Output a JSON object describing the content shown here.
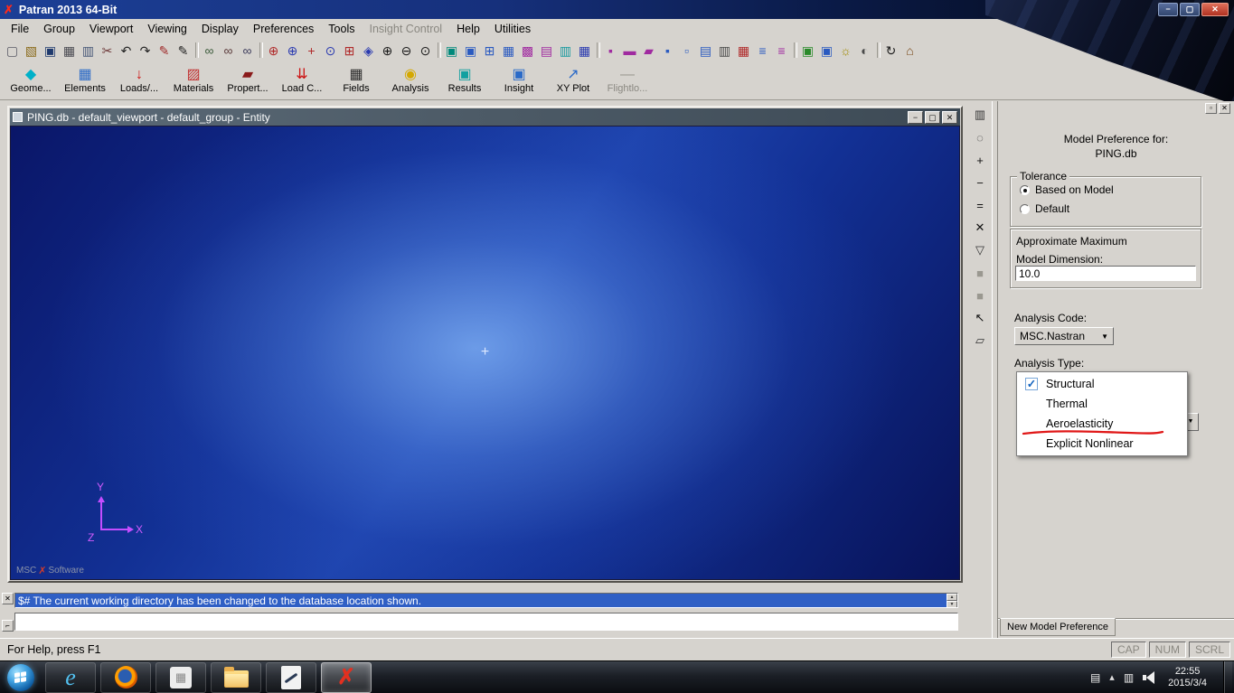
{
  "titlebar": {
    "title": "Patran 2013 64-Bit",
    "logo_glyph": "✗"
  },
  "icons": {
    "minimize": "−",
    "restore": "▢",
    "close": "✕",
    "float": "▫",
    "dock": "⌐",
    "check": "✓",
    "arrow_down": "▼",
    "arrow_up": "▲"
  },
  "menubar": {
    "items": [
      {
        "name": "menu-file",
        "label": "File"
      },
      {
        "name": "menu-group",
        "label": "Group"
      },
      {
        "name": "menu-viewport",
        "label": "Viewport"
      },
      {
        "name": "menu-viewing",
        "label": "Viewing"
      },
      {
        "name": "menu-display",
        "label": "Display"
      },
      {
        "name": "menu-preferences",
        "label": "Preferences"
      },
      {
        "name": "menu-tools",
        "label": "Tools"
      },
      {
        "name": "menu-insight-control",
        "label": "Insight Control",
        "disabled": true
      },
      {
        "name": "menu-help",
        "label": "Help"
      },
      {
        "name": "menu-utilities",
        "label": "Utilities"
      }
    ]
  },
  "toolbar_icons": [
    {
      "n": "new-file-icon",
      "g": "▢",
      "c": "#5a5a66"
    },
    {
      "n": "open-file-icon",
      "g": "▧",
      "c": "#8a6a1a"
    },
    {
      "n": "save-file-icon",
      "g": "▣",
      "c": "#1f3a6e"
    },
    {
      "n": "print-icon",
      "g": "▦",
      "c": "#4a4a52"
    },
    {
      "n": "copy-icon",
      "g": "▥",
      "c": "#4a5a7a"
    },
    {
      "n": "cut-icon",
      "g": "✂",
      "c": "#6e3a3a"
    },
    {
      "n": "undo-icon",
      "g": "↶",
      "c": "#222222"
    },
    {
      "n": "redo-icon",
      "g": "↷",
      "c": "#222222"
    },
    {
      "n": "brush-icon",
      "g": "✎",
      "c": "#a02a2a"
    },
    {
      "n": "pencil-icon",
      "g": "✎",
      "c": "#222222"
    },
    {
      "n": "toolbar-separator",
      "sep": true
    },
    {
      "n": "smooth-shaded-icon",
      "g": "∞",
      "c": "#3a5a3a"
    },
    {
      "n": "wireframe-icon",
      "g": "∞",
      "c": "#5a3a3a"
    },
    {
      "n": "hidden-line-icon",
      "g": "∞",
      "c": "#3a3a5a"
    },
    {
      "n": "toolbar-separator",
      "sep": true
    },
    {
      "n": "rotate-xy-icon",
      "g": "⊕",
      "c": "#b02a2a"
    },
    {
      "n": "rotate-z-icon",
      "g": "⊕",
      "c": "#2a3ab0"
    },
    {
      "n": "pan-icon",
      "g": "+",
      "c": "#b02a2a"
    },
    {
      "n": "center-view-icon",
      "g": "⊙",
      "c": "#2a3ab0"
    },
    {
      "n": "front-view-icon",
      "g": "⊞",
      "c": "#b02a2a"
    },
    {
      "n": "iso-view-icon",
      "g": "◈",
      "c": "#2a3ab0"
    },
    {
      "n": "zoom-in-icon",
      "g": "⊕",
      "c": "#1a1a1a"
    },
    {
      "n": "zoom-out-icon",
      "g": "⊖",
      "c": "#1a1a1a"
    },
    {
      "n": "zoom-box-icon",
      "g": "⊙",
      "c": "#1a1a1a"
    },
    {
      "n": "toolbar-separator",
      "sep": true
    },
    {
      "n": "view-cube-teal-icon",
      "g": "▣",
      "c": "#00897b"
    },
    {
      "n": "view-cube-blue-icon",
      "g": "▣",
      "c": "#2a5ac0"
    },
    {
      "n": "view-corner-icon",
      "g": "⊞",
      "c": "#2a5ac0"
    },
    {
      "n": "view-grid-icon",
      "g": "▦",
      "c": "#2a5ac0"
    },
    {
      "n": "label-grid-icon",
      "g": "▩",
      "c": "#a02aa0"
    },
    {
      "n": "show-labels-icon",
      "g": "▤",
      "c": "#a02aa0"
    },
    {
      "n": "hide-labels-icon",
      "g": "▥",
      "c": "#1a9aa0"
    },
    {
      "n": "plot-markers-icon",
      "g": "▦",
      "c": "#2a3ab0"
    },
    {
      "n": "toolbar-separator",
      "sep": true
    },
    {
      "n": "point-label-icon",
      "g": "▪",
      "c": "#a02aa0"
    },
    {
      "n": "curve-label-icon",
      "g": "▬",
      "c": "#a02aa0"
    },
    {
      "n": "surface-label-icon",
      "g": "▰",
      "c": "#a02aa0"
    },
    {
      "n": "node-label-icon",
      "g": "▪",
      "c": "#2a5ac0"
    },
    {
      "n": "element-label-icon",
      "g": "▫",
      "c": "#2a5ac0"
    },
    {
      "n": "entity-labels-icon",
      "g": "▤",
      "c": "#2a5ac0"
    },
    {
      "n": "clear-labels-icon",
      "g": "▥",
      "c": "#4a4a4a"
    },
    {
      "n": "erase-plot-icon",
      "g": "▦",
      "c": "#b02a2a"
    },
    {
      "n": "list-blue-icon",
      "g": "≡",
      "c": "#2a5ac0"
    },
    {
      "n": "list-magenta-icon",
      "g": "≡",
      "c": "#a02aa0"
    },
    {
      "n": "toolbar-separator",
      "sep": true
    },
    {
      "n": "render-green-icon",
      "g": "▣",
      "c": "#2a8a2a"
    },
    {
      "n": "render-blue-icon",
      "g": "▣",
      "c": "#2a5ac0"
    },
    {
      "n": "light-icon",
      "g": "☼",
      "c": "#a08a00"
    },
    {
      "n": "shade-icon",
      "g": "◐",
      "c": "#4a4a4a"
    },
    {
      "n": "toolbar-separator",
      "sep": true
    },
    {
      "n": "refresh-graphics-icon",
      "g": "↻",
      "c": "#1a1a1a"
    },
    {
      "n": "home-icon",
      "g": "⌂",
      "c": "#7a4a1a"
    }
  ],
  "app_toolbar": {
    "buttons": [
      {
        "name": "toolbar-geometry-button",
        "label": "Geome...",
        "glyph": "◆",
        "color": "#00b0c8"
      },
      {
        "name": "toolbar-elements-button",
        "label": "Elements",
        "glyph": "▦",
        "color": "#2a6ac8"
      },
      {
        "name": "toolbar-loads-button",
        "label": "Loads/...",
        "glyph": "↓",
        "color": "#cc1414"
      },
      {
        "name": "toolbar-materials-button",
        "label": "Materials",
        "glyph": "▨",
        "color": "#c03030"
      },
      {
        "name": "toolbar-properties-button",
        "label": "Propert...",
        "glyph": "▰",
        "color": "#8a1a1a"
      },
      {
        "name": "toolbar-load-cases-button",
        "label": "Load C...",
        "glyph": "⇊",
        "color": "#cc1414"
      },
      {
        "name": "toolbar-fields-button",
        "label": "Fields",
        "glyph": "▦",
        "color": "#2a2a2a"
      },
      {
        "name": "toolbar-analysis-button",
        "label": "Analysis",
        "glyph": "◉",
        "color": "#d4a800"
      },
      {
        "name": "toolbar-results-button",
        "label": "Results",
        "glyph": "▣",
        "color": "#12a0a0"
      },
      {
        "name": "toolbar-insight-button",
        "label": "Insight",
        "glyph": "▣",
        "color": "#2a6ac8"
      },
      {
        "name": "toolbar-xyplot-button",
        "label": "XY Plot",
        "glyph": "↗",
        "color": "#2a6ac8"
      },
      {
        "name": "toolbar-flightloads-button",
        "label": "Flightlo...",
        "glyph": "—",
        "color": "#9a9890",
        "disabled": true
      }
    ]
  },
  "viewport": {
    "title": "PING.db - default_viewport - default_group - Entity",
    "center_marker": "+",
    "axis": {
      "x": "X",
      "y": "Y",
      "z": "Z"
    },
    "watermark": {
      "left": "MSC",
      "logo": "✗",
      "right": "Software"
    }
  },
  "side_toolbar": [
    {
      "n": "viewport-tool-icon",
      "g": "▥",
      "c": "#333333"
    },
    {
      "n": "lasso-icon",
      "g": "◌",
      "c": "#333333"
    },
    {
      "n": "zoom-in-icon",
      "g": "+",
      "c": "#111111"
    },
    {
      "n": "zoom-out-icon",
      "g": "−",
      "c": "#111111"
    },
    {
      "n": "fit-view-icon",
      "g": "=",
      "c": "#111111"
    },
    {
      "n": "clear-icon",
      "g": "✕",
      "c": "#111111"
    },
    {
      "n": "filter-icon",
      "g": "▽",
      "c": "#333333"
    },
    {
      "n": "tool-gray-a-icon",
      "g": "■",
      "c": "#9a9890"
    },
    {
      "n": "tool-gray-b-icon",
      "g": "■",
      "c": "#9a9890"
    },
    {
      "n": "pointer-icon",
      "g": "↖",
      "c": "#111111"
    },
    {
      "n": "polygon-pick-icon",
      "g": "▱",
      "c": "#333333"
    }
  ],
  "right_panel": {
    "header_line1": "Model Preference for:",
    "header_line2": "PING.db",
    "tolerance": {
      "label": "Tolerance",
      "options": [
        {
          "name": "radio-based-on-model",
          "label": "Based on Model",
          "selected": true
        },
        {
          "name": "radio-default",
          "label": "Default",
          "selected": false
        }
      ]
    },
    "approx_max": {
      "label_line1": "Approximate Maximum",
      "label_line2": "Model Dimension:",
      "value": "10.0"
    },
    "analysis_code": {
      "label": "Analysis Code:",
      "value": "MSC.Nastran"
    },
    "analysis_type": {
      "label": "Analysis Type:",
      "options": [
        {
          "name": "option-structural",
          "label": "Structural",
          "checked": true
        },
        {
          "name": "option-thermal",
          "label": "Thermal"
        },
        {
          "name": "option-aeroelasticity",
          "label": "Aeroelasticity",
          "annotated": true
        },
        {
          "name": "option-explicit-nonlinear",
          "label": "Explicit Nonlinear"
        }
      ]
    },
    "tab_label": "New Model Preference"
  },
  "message_area": {
    "history_line": "$# The current working directory has been changed to the database location shown.",
    "command_value": ""
  },
  "status_bar": {
    "help_text": "For Help, press F1",
    "indicators": [
      {
        "name": "caps-lock-indicator",
        "label": "CAP"
      },
      {
        "name": "num-lock-indicator",
        "label": "NUM"
      },
      {
        "name": "scroll-lock-indicator",
        "label": "SCRL"
      }
    ]
  },
  "taskbar": {
    "items": [
      {
        "name": "internet-explorer",
        "glyph": "e"
      },
      {
        "name": "firefox"
      },
      {
        "name": "media-app"
      },
      {
        "name": "file-explorer"
      },
      {
        "name": "windows-journal"
      },
      {
        "name": "patran",
        "glyph": "✗",
        "active": true
      }
    ],
    "tray": {
      "time": "22:55",
      "date": "2015/3/4"
    }
  }
}
